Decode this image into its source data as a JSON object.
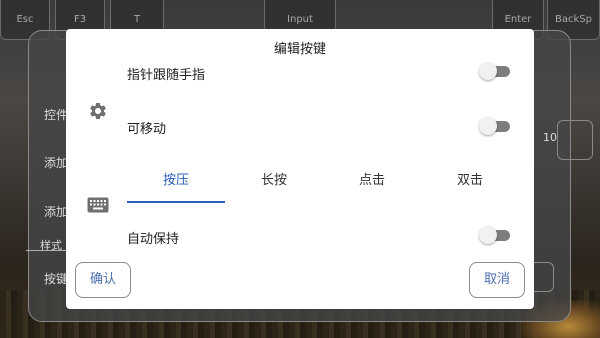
{
  "background_keys": {
    "esc": "Esc",
    "f3": "F3",
    "t": "T",
    "input": "Input",
    "enter": "Enter",
    "backsp": "BackSp"
  },
  "background_panel": {
    "row1": "控件",
    "row2": "添加",
    "row3": "添加",
    "row4": "样式",
    "row5": "按键",
    "value": "10"
  },
  "dialog": {
    "title": "编辑按键",
    "follow_finger_label": "指针跟随手指",
    "follow_finger_on": false,
    "movable_label": "可移动",
    "movable_on": false,
    "tabs": [
      {
        "label": "按压",
        "active": true
      },
      {
        "label": "长按",
        "active": false
      },
      {
        "label": "点击",
        "active": false
      },
      {
        "label": "双击",
        "active": false
      }
    ],
    "auto_hold_label": "自动保持",
    "auto_hold_on": false,
    "confirm_label": "确认",
    "cancel_label": "取消"
  },
  "colors": {
    "accent": "#2a5fb5",
    "toggle_track_off": "#7d7d7d",
    "dialog_bg": "#ffffff"
  },
  "icons": [
    "gear-icon",
    "keyboard-icon"
  ]
}
